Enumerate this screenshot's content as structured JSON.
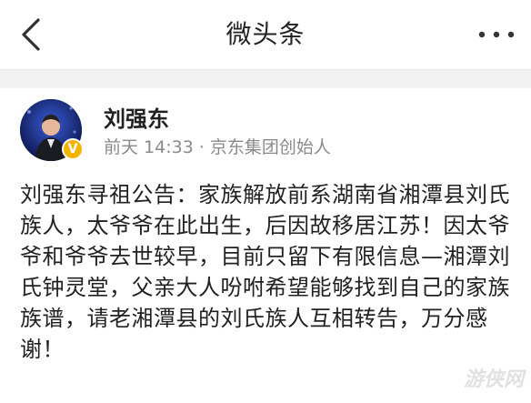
{
  "nav": {
    "title": "微头条",
    "back_icon": "chevron-left-icon",
    "more_icon": "more-dots-icon"
  },
  "post": {
    "author": "刘强东",
    "time": "前天 14:33",
    "separator": "·",
    "author_title": "京东集团创始人",
    "verified_icon": "verified-v-icon",
    "content": "刘强东寻祖公告：家族解放前系湖南省湘潭县刘氏族人，太爷爷在此出生，后因故移居江苏！因太爷爷和爷爷去世较早，目前只留下有限信息—湘潭刘氏钟灵堂，父亲大人吩咐希望能够找到自己的家族族谱，请老湘潭县的刘氏族人互相转告，万分感谢！"
  },
  "watermark": "游侠网",
  "colors": {
    "background": "#ffffff",
    "divider_gap": "#f2f2f2",
    "text_primary": "#222222",
    "text_secondary": "#8a8a8a",
    "verified_badge": "#f5b400"
  }
}
